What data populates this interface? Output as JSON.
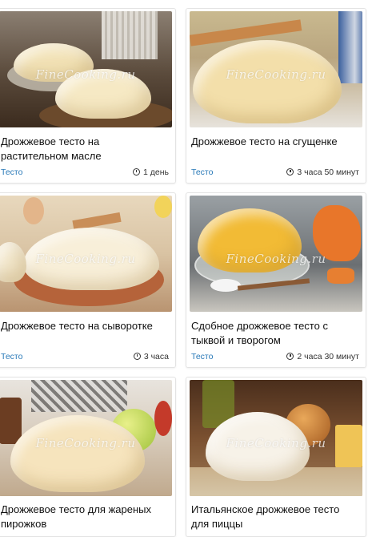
{
  "watermark": "FineCooking.ru",
  "cards": [
    {
      "title": "Дрожжевое тесто на растительном масле",
      "category": "Тесто",
      "time": "1 день"
    },
    {
      "title": "Дрожжевое тесто на сгущенке",
      "category": "Тесто",
      "time": "3 часа 50 минут"
    },
    {
      "title": "Дрожжевое тесто на сыворотке",
      "category": "Тесто",
      "time": "3 часа"
    },
    {
      "title": "Сдобное дрожжевое тесто с тыквой и творогом",
      "category": "Тесто",
      "time": "2 часа 30 минут"
    },
    {
      "title": "Дрожжевое тесто для жареных пирожков"
    },
    {
      "title": "Итальянское дрожжевое тесто для пиццы"
    }
  ]
}
